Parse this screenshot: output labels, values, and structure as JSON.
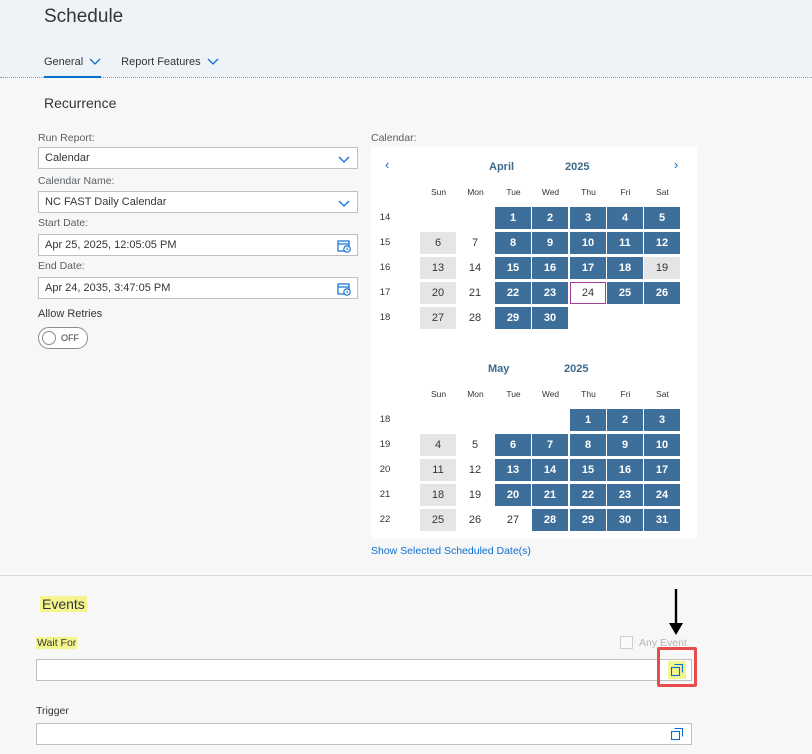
{
  "header": {
    "title": "Schedule",
    "tabs": [
      {
        "label": "General"
      },
      {
        "label": "Report Features"
      }
    ]
  },
  "recurrence": {
    "title": "Recurrence",
    "run_report": {
      "label": "Run Report:",
      "value": "Calendar"
    },
    "calendar_name": {
      "label": "Calendar Name:",
      "value": "NC FAST Daily Calendar"
    },
    "start_date": {
      "label": "Start Date:",
      "value": "Apr 25, 2025, 12:05:05 PM"
    },
    "end_date": {
      "label": "End Date:",
      "value": "Apr 24, 2035, 3:47:05 PM"
    },
    "allow_retries": {
      "label": "Allow Retries",
      "state": "OFF"
    }
  },
  "calendar": {
    "label": "Calendar:",
    "prev_glyph": "‹",
    "next_glyph": "›",
    "weekdays": [
      "Sun",
      "Mon",
      "Tue",
      "Wed",
      "Thu",
      "Fri",
      "Sat"
    ],
    "months": [
      {
        "name": "April",
        "year": "2025",
        "weeks": [
          {
            "week": "14",
            "days": [
              "",
              "",
              "1",
              "2",
              "3",
              "4",
              "5"
            ],
            "styles": [
              "",
              "",
              "sel",
              "sel",
              "sel",
              "sel",
              "sel"
            ]
          },
          {
            "week": "15",
            "days": [
              "6",
              "7",
              "8",
              "9",
              "10",
              "11",
              "12"
            ],
            "styles": [
              "wkend",
              "plain",
              "sel",
              "sel",
              "sel",
              "sel",
              "sel"
            ]
          },
          {
            "week": "16",
            "days": [
              "13",
              "14",
              "15",
              "16",
              "17",
              "18",
              "19"
            ],
            "styles": [
              "wkend",
              "plain",
              "sel",
              "sel",
              "sel",
              "sel",
              "wkend"
            ]
          },
          {
            "week": "17",
            "days": [
              "20",
              "21",
              "22",
              "23",
              "24",
              "25",
              "26"
            ],
            "styles": [
              "wkend",
              "plain",
              "sel",
              "sel",
              "today",
              "sel",
              "sel"
            ]
          },
          {
            "week": "18",
            "days": [
              "27",
              "28",
              "29",
              "30",
              "",
              "",
              ""
            ],
            "styles": [
              "wkend",
              "plain",
              "sel",
              "sel",
              "",
              "",
              ""
            ]
          }
        ]
      },
      {
        "name": "May",
        "year": "2025",
        "weeks": [
          {
            "week": "18",
            "days": [
              "",
              "",
              "",
              "",
              "1",
              "2",
              "3"
            ],
            "styles": [
              "",
              "",
              "",
              "",
              "sel",
              "sel",
              "sel"
            ]
          },
          {
            "week": "19",
            "days": [
              "4",
              "5",
              "6",
              "7",
              "8",
              "9",
              "10"
            ],
            "styles": [
              "wkend",
              "plain",
              "sel",
              "sel",
              "sel",
              "sel",
              "sel"
            ]
          },
          {
            "week": "20",
            "days": [
              "11",
              "12",
              "13",
              "14",
              "15",
              "16",
              "17"
            ],
            "styles": [
              "wkend",
              "plain",
              "sel",
              "sel",
              "sel",
              "sel",
              "sel"
            ]
          },
          {
            "week": "21",
            "days": [
              "18",
              "19",
              "20",
              "21",
              "22",
              "23",
              "24"
            ],
            "styles": [
              "wkend",
              "plain",
              "sel",
              "sel",
              "sel",
              "sel",
              "sel"
            ]
          },
          {
            "week": "22",
            "days": [
              "25",
              "26",
              "27",
              "28",
              "29",
              "30",
              "31"
            ],
            "styles": [
              "wkend",
              "plain",
              "plain",
              "sel",
              "sel",
              "sel",
              "sel"
            ]
          }
        ]
      }
    ],
    "show_link": "Show Selected Scheduled Date(s)"
  },
  "events": {
    "title": "Events",
    "wait_for": {
      "label": "Wait For",
      "value": ""
    },
    "any_event": {
      "label": "Any Event",
      "checked": false
    },
    "trigger": {
      "label": "Trigger",
      "value": ""
    }
  },
  "colors": {
    "selected_day": "#3e6f9b",
    "weekend_day": "#e5e5e5",
    "today_outline": "#a33f97",
    "highlight": "#f5f58d",
    "annotation_red": "#e74c4c",
    "link": "#0a6ed1"
  }
}
